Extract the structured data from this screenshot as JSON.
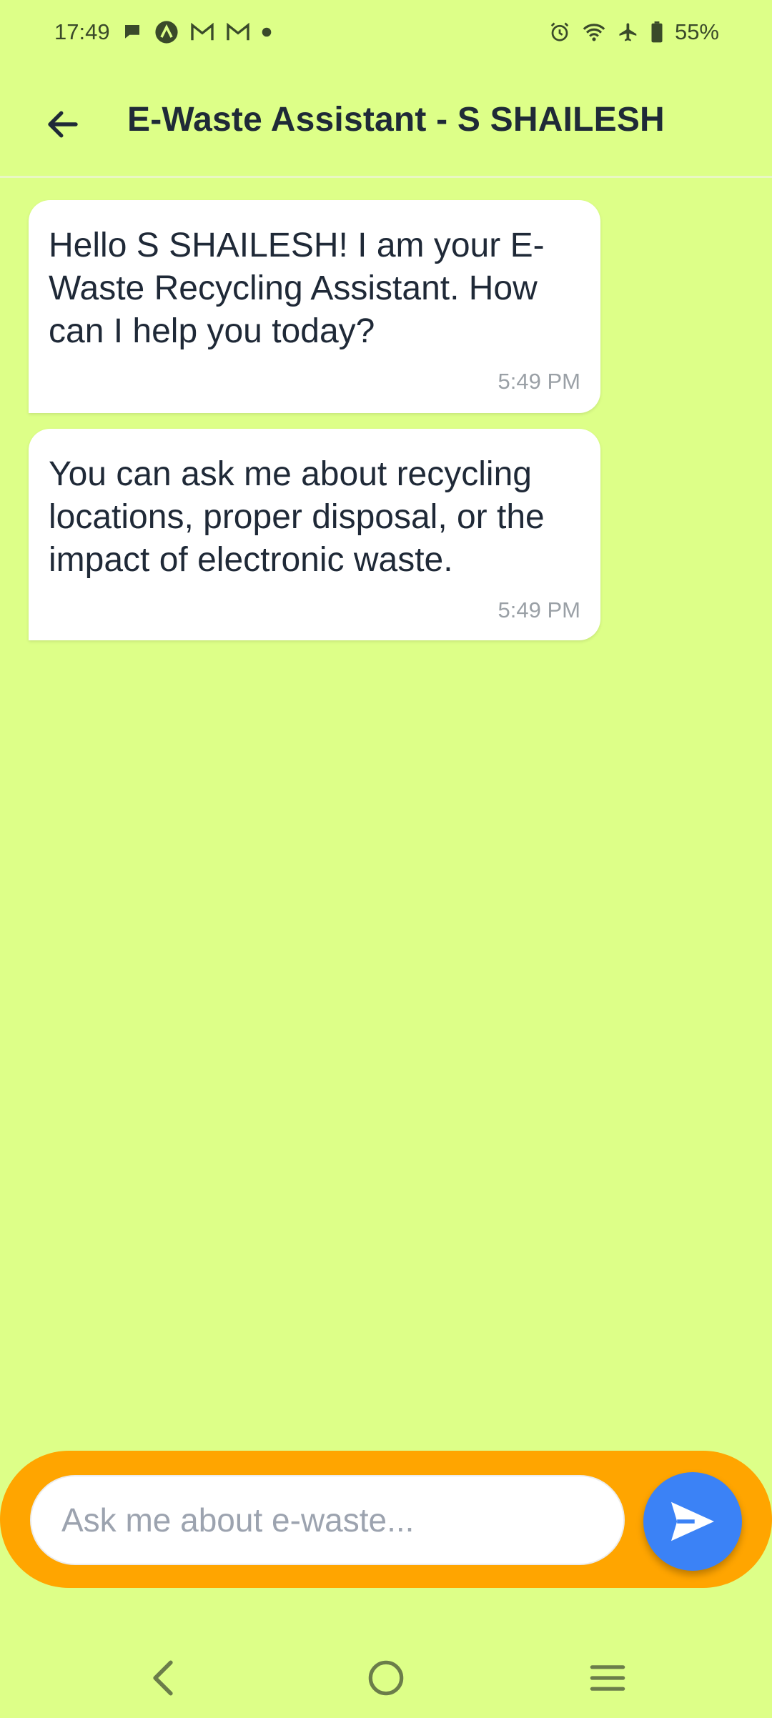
{
  "status_bar": {
    "time": "17:49",
    "battery": "55%",
    "icons_left": [
      "chat-bubble-icon",
      "app-a-icon",
      "gmail-icon",
      "gmail-icon",
      "dot-icon"
    ],
    "icons_right": [
      "alarm-icon",
      "wifi-icon",
      "airplane-icon",
      "battery-icon"
    ]
  },
  "header": {
    "title": "E-Waste Assistant - S SHAILESH",
    "back_icon": "arrow-left-icon"
  },
  "messages": [
    {
      "text": "Hello S SHAILESH! I am your E-Waste Recycling Assistant. How can I help you today?",
      "time": "5:49 PM"
    },
    {
      "text": "You can ask me about recycling locations, proper disposal, or the impact of electronic waste.",
      "time": "5:49 PM"
    }
  ],
  "composer": {
    "placeholder": "Ask me about e-waste...",
    "send_icon": "send-icon"
  },
  "nav": {
    "back_icon": "nav-back-icon",
    "home_icon": "nav-home-icon",
    "recents_icon": "nav-menu-icon"
  },
  "colors": {
    "background": "#DDFF88",
    "composer_bar": "#FFA500",
    "send_button": "#3B82F6",
    "bubble": "#FFFFFF"
  }
}
